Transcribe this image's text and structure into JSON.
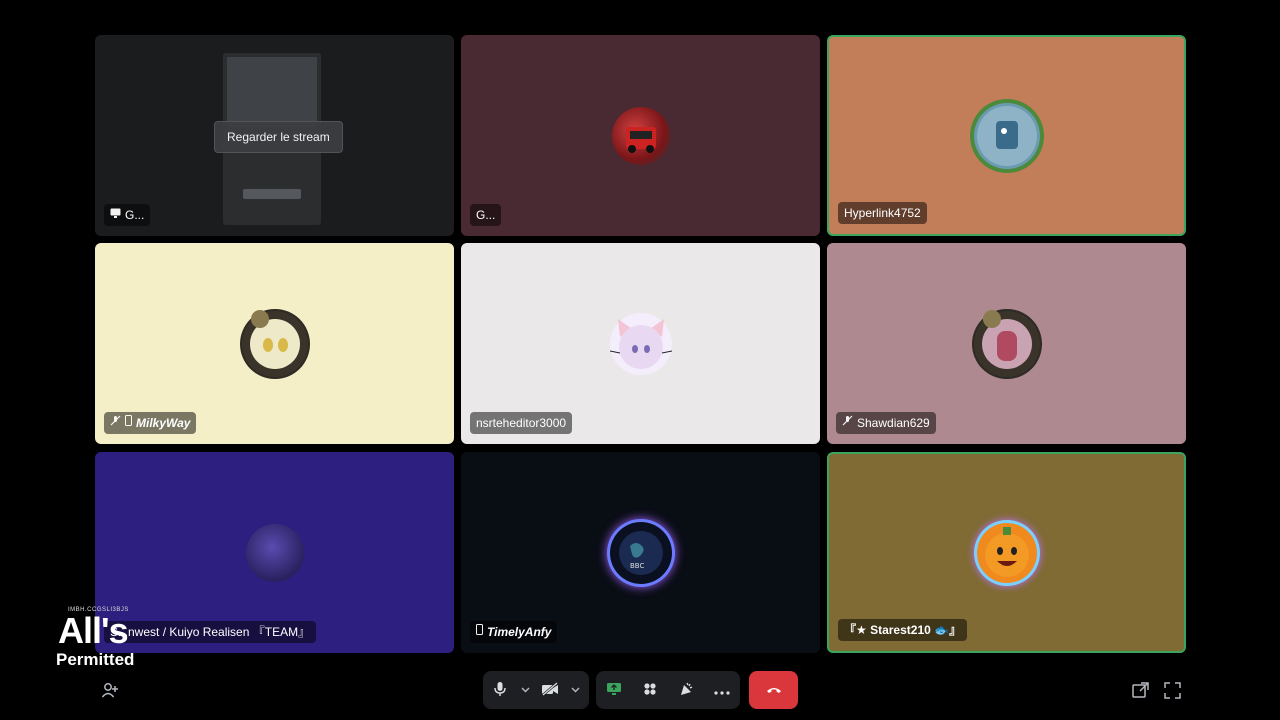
{
  "tiles": [
    {
      "id": "screen-share",
      "bg": "#1b1c1e",
      "label": "G...",
      "label_icon": "screen-share-icon",
      "watch_label": "Regarder le stream",
      "speaking": false
    },
    {
      "id": "g-user",
      "bg": "#4a2a32",
      "label": "G...",
      "speaking": false
    },
    {
      "id": "hyperlink",
      "bg": "#c27d59",
      "label": "Hyperlink4752",
      "speaking": true
    },
    {
      "id": "milkyway",
      "bg": "#f4efc6",
      "label": "MilkyWay",
      "label_icon": "muted-mic-icon, mobile-icon",
      "speaking": false
    },
    {
      "id": "nsrteheditor",
      "bg": "#ebe8e9",
      "label": "nsrteheditor3000",
      "speaking": false
    },
    {
      "id": "shawdian",
      "bg": "#ae8a90",
      "label": "Shawdian629",
      "label_icon": "muted-mic-icon",
      "speaking": false
    },
    {
      "id": "kuiyo",
      "bg": "#2c1f7f",
      "label": "S...nwest / Kuiyo Realisen 『TEAM』",
      "speaking": false
    },
    {
      "id": "timelyanfy",
      "bg": "#090d14",
      "label": "TimelyAnfy",
      "label_icon": "mobile-icon",
      "speaking": false
    },
    {
      "id": "starest",
      "bg": "#7f6b33",
      "label": "『★ Starest210 🐟』",
      "speaking": true
    }
  ],
  "controls": {
    "mic": "microphone-icon",
    "camera": "camera-off-icon",
    "screen": "screen-share-icon",
    "activities": "activities-icon",
    "soundboard": "soundboard-icon",
    "more": "more-icon",
    "hangup": "hang-up-icon",
    "accent": "#da373c",
    "speaking_color": "#3ba55d"
  },
  "corner_icons": {
    "invite": "add-user-icon",
    "popout": "popout-icon",
    "fullscreen": "fullscreen-icon"
  },
  "watermark": {
    "top": "IMBH.CCGSLI3BJS",
    "main": "All's",
    "sub": "Permitted"
  }
}
